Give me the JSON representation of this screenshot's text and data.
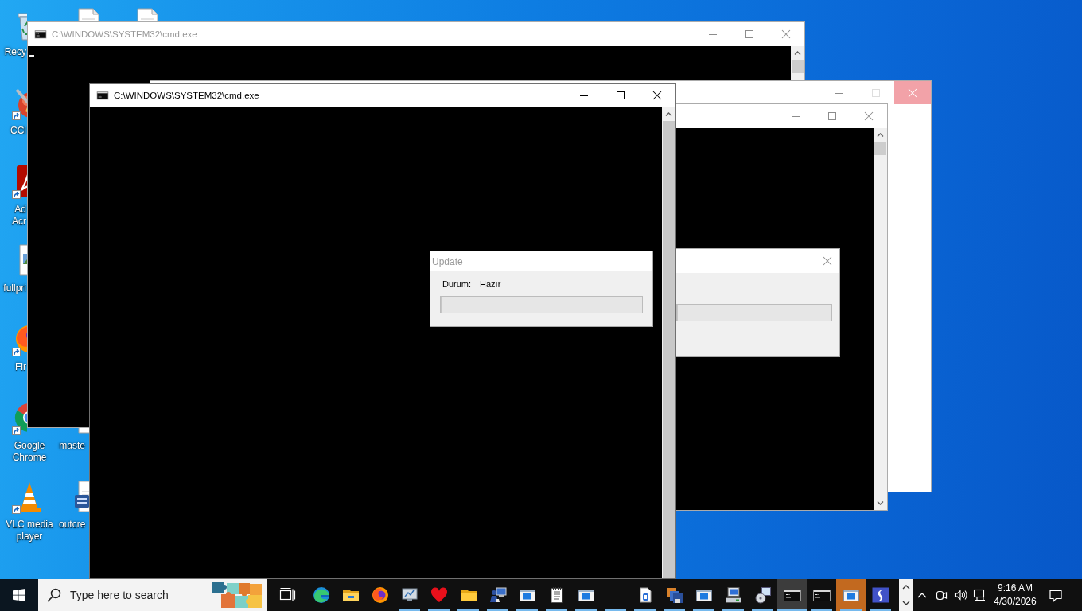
{
  "desktop_icons": [
    {
      "label": [
        "Recy"
      ],
      "shortcut": false
    },
    {
      "label": [
        "CCl"
      ],
      "shortcut": true
    },
    {
      "label": [
        "Ad",
        "Acr"
      ],
      "shortcut": true
    },
    {
      "label": [
        "fullpri"
      ],
      "shortcut": false
    },
    {
      "label": [
        "Fir"
      ],
      "shortcut": true
    },
    {
      "label": [
        "Google",
        "Chrome"
      ],
      "shortcut": true
    },
    {
      "label": [
        "VLC media",
        "player"
      ],
      "shortcut": true
    },
    {
      "shortcut": false
    },
    {
      "label": [
        "maste"
      ],
      "shortcut": false
    },
    {
      "label": [
        "outcre"
      ],
      "shortcut": false
    },
    {
      "shortcut": false
    }
  ],
  "windows": [
    {
      "kind": "console",
      "title": "C:\\WINDOWS\\SYSTEM32\\cmd.exe",
      "active": false,
      "cursor": true,
      "buttons": [
        {
          "kind": "minimize",
          "disabled": false,
          "highlighted": false
        },
        {
          "kind": "maximize",
          "disabled": false,
          "highlighted": false
        },
        {
          "kind": "close",
          "disabled": false,
          "highlighted": false
        }
      ]
    },
    {
      "kind": "blank",
      "active": false,
      "buttons": [
        {
          "kind": "minimize",
          "disabled": false,
          "highlighted": false
        },
        {
          "kind": "maximize",
          "disabled": true,
          "highlighted": false
        },
        {
          "kind": "close",
          "disabled": false,
          "highlighted": true
        }
      ]
    },
    {
      "kind": "console",
      "active": false,
      "cursor": false,
      "buttons": [
        {
          "kind": "minimize",
          "disabled": false,
          "highlighted": false
        },
        {
          "kind": "maximize",
          "disabled": false,
          "highlighted": false
        },
        {
          "kind": "close",
          "disabled": false,
          "highlighted": false
        }
      ]
    },
    {
      "kind": "dialog",
      "active": false,
      "buttons": [
        {
          "kind": "close",
          "disabled": false,
          "highlighted": false
        }
      ],
      "progress": {
        "level": 0
      }
    },
    {
      "kind": "console",
      "title": "C:\\WINDOWS\\SYSTEM32\\cmd.exe",
      "active": true,
      "cursor": false,
      "buttons": [
        {
          "kind": "minimize",
          "disabled": false,
          "highlighted": false
        },
        {
          "kind": "maximize",
          "disabled": false,
          "highlighted": false
        },
        {
          "kind": "close",
          "disabled": false,
          "highlighted": false
        }
      ]
    },
    {
      "kind": "dialog",
      "title": "Update",
      "active": false,
      "status_label": "Durum:",
      "status_value": "Hazır",
      "progress": {
        "level": 0
      }
    }
  ],
  "taskbar": {
    "search": {
      "placeholder": "Type here to search"
    },
    "apps": [
      {
        "running": false,
        "active": false,
        "attention": false
      },
      {
        "running": false,
        "active": false,
        "attention": false
      },
      {
        "running": false,
        "active": false,
        "attention": false
      },
      {
        "running": true,
        "active": false,
        "attention": false
      },
      {
        "running": true,
        "active": false,
        "attention": false
      },
      {
        "running": true,
        "active": false,
        "attention": false
      },
      {
        "running": true,
        "active": false,
        "attention": false
      },
      {
        "running": true,
        "active": false,
        "attention": false
      },
      {
        "running": true,
        "active": false,
        "attention": false
      },
      {
        "running": true,
        "active": false,
        "attention": false
      },
      {
        "running": true,
        "active": false,
        "attention": false
      },
      {
        "running": true,
        "active": false,
        "attention": false
      },
      {
        "running": true,
        "active": false,
        "attention": false
      },
      {
        "running": true,
        "active": false,
        "attention": false
      },
      {
        "running": true,
        "active": false,
        "attention": false
      },
      {
        "running": true,
        "active": false,
        "attention": false
      },
      {
        "running": true,
        "active": true,
        "attention": false
      },
      {
        "running": true,
        "active": false,
        "attention": false
      },
      {
        "running": true,
        "active": false,
        "attention": true
      },
      {
        "running": true,
        "active": false,
        "attention": false
      }
    ],
    "clock": {
      "time": "9:16 AM",
      "date": "4/30/2026"
    }
  }
}
